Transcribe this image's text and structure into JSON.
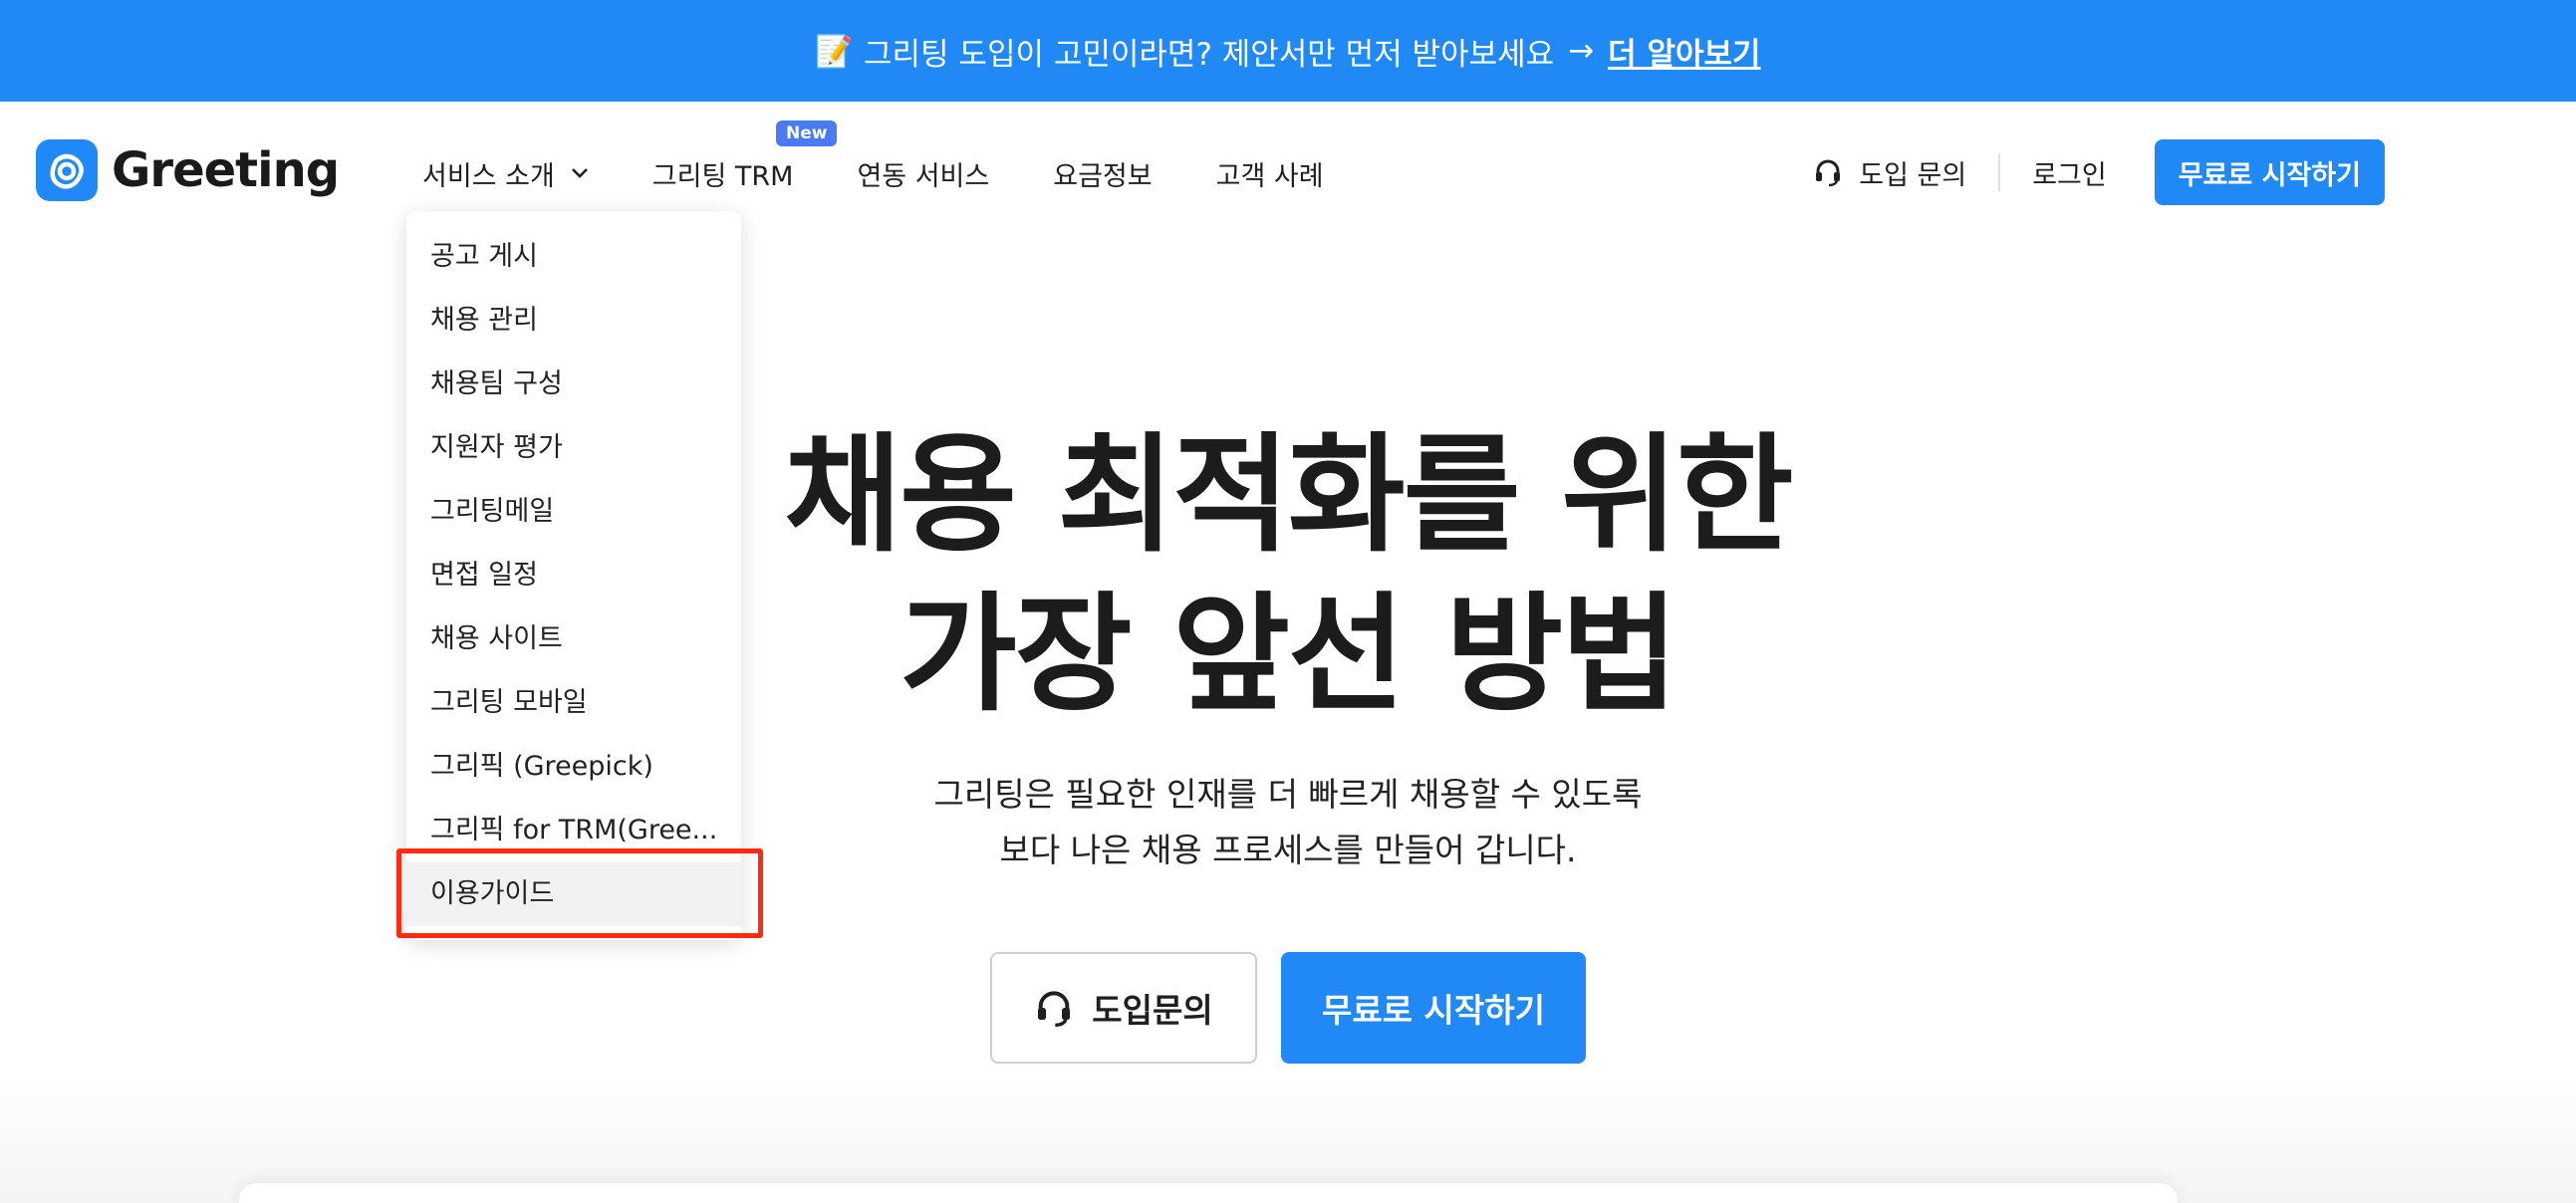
{
  "banner": {
    "icon": "memo-icon",
    "message": "그리팅 도입이 고민이라면? 제안서만 먼저 받아보세요",
    "arrow": "→",
    "link_label": "더 알아보기"
  },
  "header": {
    "logo_text": "Greeting",
    "nav": [
      {
        "label": "서비스 소개"
      },
      {
        "label": "그리팅 TRM",
        "badge": "New"
      },
      {
        "label": "연동 서비스"
      },
      {
        "label": "요금정보"
      },
      {
        "label": "고객 사례"
      }
    ],
    "inquiry_label": "도입 문의",
    "login_label": "로그인",
    "start_label": "무료로 시작하기"
  },
  "dropdown": {
    "items": [
      {
        "label": "공고 게시"
      },
      {
        "label": "채용 관리"
      },
      {
        "label": "채용팀 구성"
      },
      {
        "label": "지원자 평가"
      },
      {
        "label": "그리팅메일"
      },
      {
        "label": "면접 일정"
      },
      {
        "label": "채용 사이트"
      },
      {
        "label": "그리팅 모바일"
      },
      {
        "label": "그리픽 (Greepick)"
      },
      {
        "label": "그리픽 for TRM(Gree..."
      },
      {
        "label": "이용가이드"
      }
    ]
  },
  "hero": {
    "title_line1": "채용 최적화를 위한",
    "title_line2": "가장 앞선 방법",
    "subtitle_line1": "그리팅은 필요한 인재를 더 빠르게 채용할 수 있도록",
    "subtitle_line2": "보다 나은 채용 프로세스를 만들어 갑니다.",
    "inquiry_button": "도입문의",
    "start_button": "무료로 시작하기"
  },
  "colors": {
    "brand": "#2189f5",
    "badge": "#4b7bf0",
    "annotation": "#ff2a10"
  }
}
